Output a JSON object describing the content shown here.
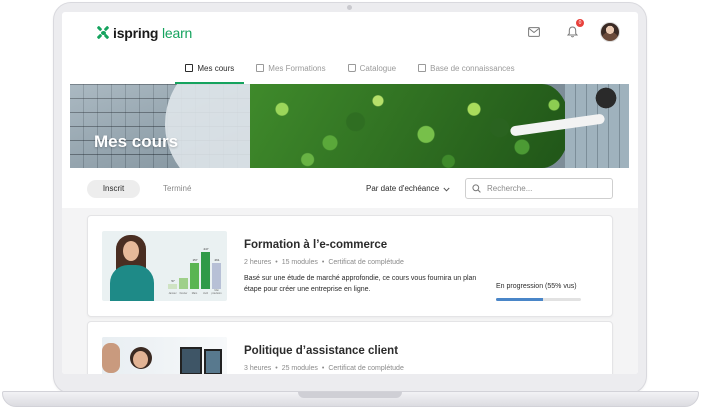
{
  "app": {
    "logo_brand": "ispring",
    "logo_product": "learn",
    "notification_count": "0"
  },
  "colors": {
    "accent": "#15a35e",
    "progress": "#4a86c8",
    "badge": "#e8413c"
  },
  "nav": {
    "tabs": [
      {
        "label": "Mes cours",
        "icon": "book-icon",
        "active": true
      },
      {
        "label": "Mes Formations",
        "icon": "calendar-icon",
        "active": false
      },
      {
        "label": "Catalogue",
        "icon": "bag-icon",
        "active": false
      },
      {
        "label": "Base de connaissances",
        "icon": "document-icon",
        "active": false
      }
    ]
  },
  "banner": {
    "title": "Mes cours"
  },
  "filters": {
    "tab_enrolled": "Inscrit",
    "tab_completed": "Terminé",
    "sort_label": "Par date d'echéance",
    "search_placeholder": "Recherche..."
  },
  "courses": [
    {
      "title": "Formation à l’e-commerce",
      "duration": "2 heures",
      "modules": "15 modules",
      "certificate": "Certificat de complétude",
      "description": "Basé sur une étude de marché approfondie, ce cours vous fournira un plan étape pour créer une entreprise en ligne.",
      "progress_label": "En progression (55% vus)",
      "progress": 0.55,
      "thumbnail": {
        "bar_values": [
          "57",
          "157",
          "247",
          "261"
        ],
        "bar_labels": [
          "Janvier",
          "Février",
          "Mars",
          "Avril",
          "Mai prévision"
        ]
      }
    },
    {
      "title": "Politique d’assistance client",
      "duration": "3 heures",
      "modules": "25 modules",
      "certificate": "Certificat de complétude"
    }
  ]
}
